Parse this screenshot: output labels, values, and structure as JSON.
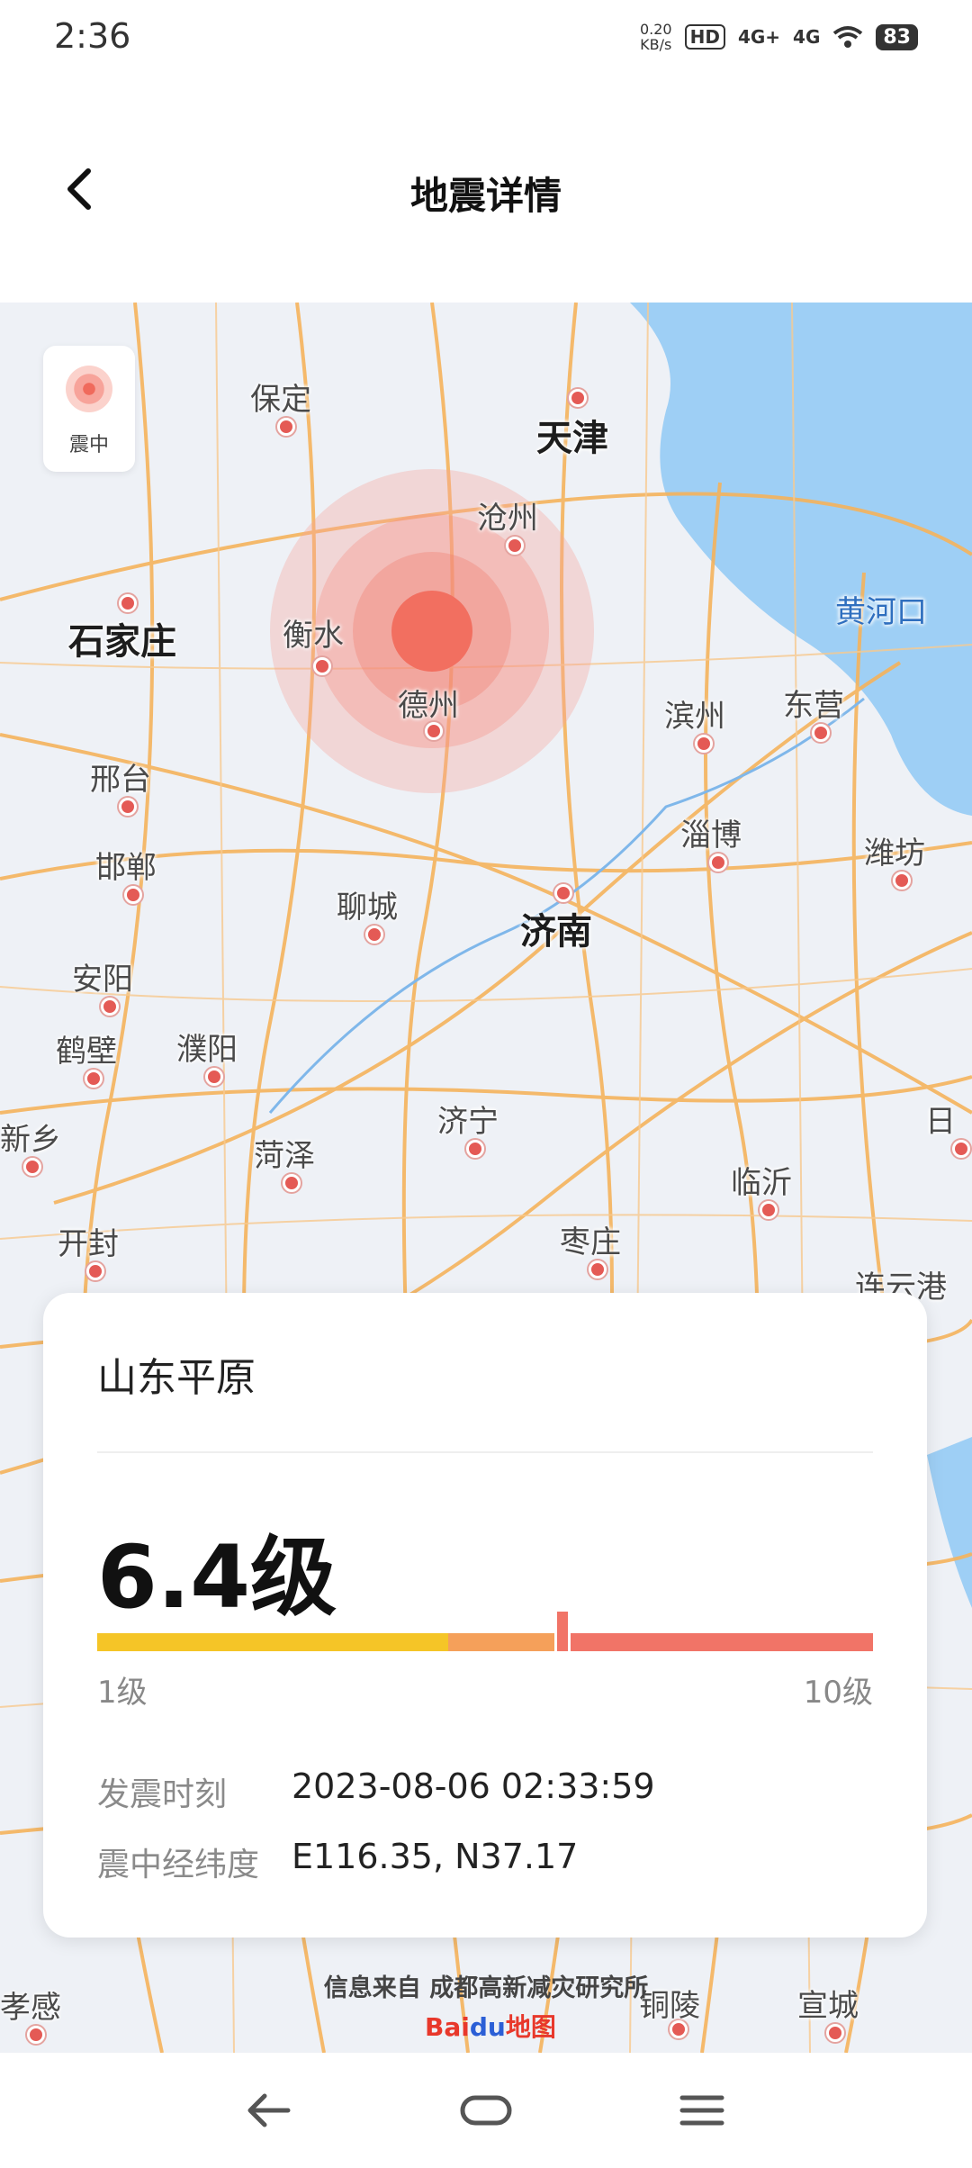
{
  "status_bar": {
    "time": "2:36",
    "net_speed_value": "0.20",
    "net_speed_unit": "KB/s",
    "hd": "HD",
    "signal1": "4G+",
    "signal2": "4G",
    "battery": "83"
  },
  "header": {
    "title": "地震详情",
    "back_icon": "back-arrow-icon"
  },
  "map": {
    "legend_label": "震中",
    "cities": [
      {
        "name": "保定"
      },
      {
        "name": "天津"
      },
      {
        "name": "沧州"
      },
      {
        "name": "石家庄"
      },
      {
        "name": "衡水"
      },
      {
        "name": "黄河口"
      },
      {
        "name": "德州"
      },
      {
        "name": "滨州"
      },
      {
        "name": "东营"
      },
      {
        "name": "邢台"
      },
      {
        "name": "淄博"
      },
      {
        "name": "潍坊"
      },
      {
        "name": "邯郸"
      },
      {
        "name": "聊城"
      },
      {
        "name": "济南"
      },
      {
        "name": "安阳"
      },
      {
        "name": "鹤壁"
      },
      {
        "name": "濮阳"
      },
      {
        "name": "新乡"
      },
      {
        "name": "济宁"
      },
      {
        "name": "日"
      },
      {
        "name": "菏泽"
      },
      {
        "name": "临沂"
      },
      {
        "name": "开封"
      },
      {
        "name": "枣庄"
      },
      {
        "name": "连云港"
      },
      {
        "name": "孝感"
      },
      {
        "name": "铜陵"
      },
      {
        "name": "宣城"
      }
    ],
    "source_text": "信息来自 成都高新减灾研究所",
    "baidu_logo_a": "Bai",
    "baidu_logo_b": "du",
    "baidu_logo_c": "地图"
  },
  "card": {
    "location": "山东平原",
    "magnitude": "6.4级",
    "magnitude_value": 6.4,
    "scale_min": "1级",
    "scale_max": "10级",
    "colors": {
      "low": "#f5c527",
      "mid": "#f5a05a",
      "high": "#f17467"
    },
    "time_label": "发震时刻",
    "time_value": "2023-08-06 02:33:59",
    "coord_label": "震中经纬度",
    "coord_value": "E116.35, N37.17"
  },
  "navbar": {
    "back_icon": "nav-back-icon",
    "home_icon": "nav-home-icon",
    "menu_icon": "nav-menu-icon"
  }
}
